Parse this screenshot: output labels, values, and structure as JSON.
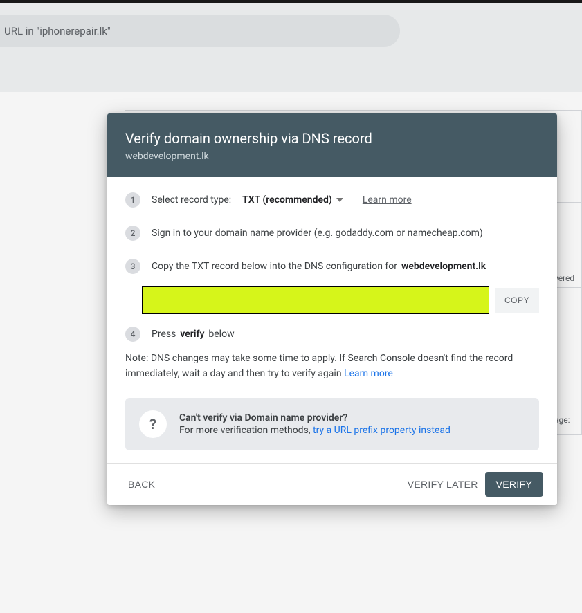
{
  "background": {
    "search_text": "URL in \"iphonerepair.lk\"",
    "peek_text_1": "vered",
    "peek_text_2": "age:"
  },
  "modal": {
    "title": "Verify domain ownership via DNS record",
    "subtitle": "webdevelopment.lk",
    "steps": {
      "s1": {
        "num": "1",
        "label": "Select record type:",
        "dropdown_value": "TXT (recommended)",
        "learn_more": "Learn more"
      },
      "s2": {
        "num": "2",
        "text": "Sign in to your domain name provider (e.g. godaddy.com or namecheap.com)"
      },
      "s3": {
        "num": "3",
        "prefix": "Copy the TXT record below into the DNS configuration for ",
        "domain": "webdevelopment.lk"
      },
      "s4": {
        "num": "4",
        "prefix": "Press ",
        "bold": "verify",
        "suffix": " below"
      }
    },
    "copy_label": "COPY",
    "note": {
      "text": "Note: DNS changes may take some time to apply. If Search Console doesn't find the record immediately, wait a day and then try to verify again ",
      "link": "Learn more"
    },
    "info": {
      "icon": "?",
      "title": "Can't verify via Domain name provider?",
      "sub_prefix": "For more verification methods, ",
      "sub_link": "try a URL prefix property instead"
    },
    "footer": {
      "back": "BACK",
      "later": "VERIFY LATER",
      "verify": "VERIFY"
    }
  }
}
